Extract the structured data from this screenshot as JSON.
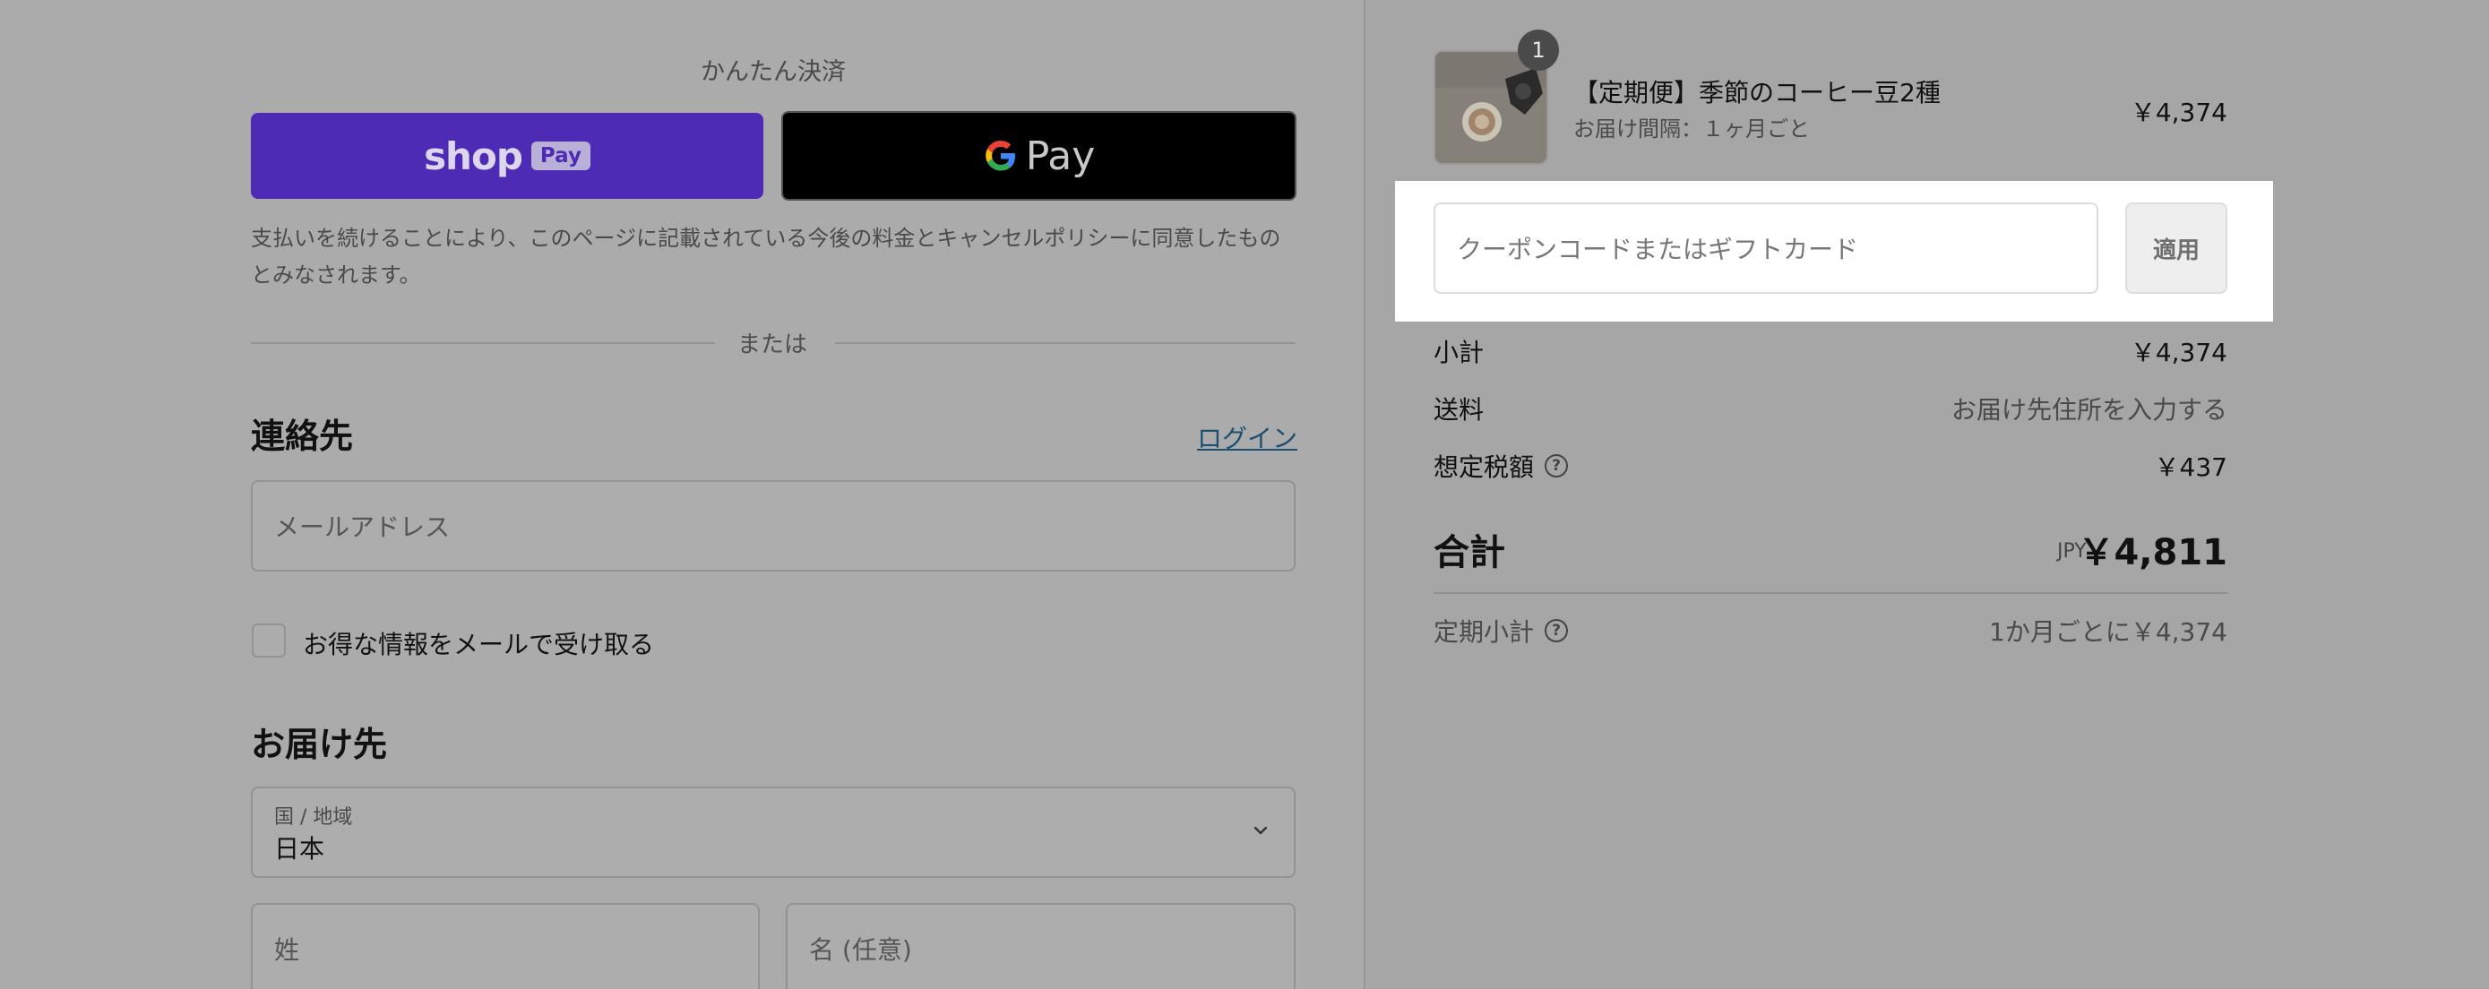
{
  "express_checkout": {
    "title": "かんたん決済",
    "shop_pay_wordmark": "shop",
    "shop_pay_badge": "Pay",
    "gpay_g": "G",
    "gpay_label": "Pay"
  },
  "notice_text": "支払いを続けることにより、このページに記載されている今後の料金とキャンセルポリシーに同意したものとみなされます。",
  "divider_text": "または",
  "contact": {
    "title": "連絡先",
    "login_link": "ログイン",
    "email_placeholder": "メールアドレス",
    "newsletter_label": "お得な情報をメールで受け取る"
  },
  "delivery": {
    "title": "お届け先",
    "country_label": "国 / 地域",
    "country_value": "日本",
    "last_name_placeholder": "姓",
    "first_name_placeholder": "名 (任意)"
  },
  "summary": {
    "item": {
      "quantity": "1",
      "title": "【定期便】季節のコーヒー豆2種",
      "subtitle": "お届け間隔：１ヶ月ごと",
      "price": "￥4,374"
    },
    "coupon": {
      "placeholder": "クーポンコードまたはギフトカード",
      "apply_label": "適用"
    },
    "subtotal_label": "小計",
    "subtotal_value": "￥4,374",
    "shipping_label": "送料",
    "shipping_value": "お届け先住所を入力する",
    "tax_label": "想定税額",
    "tax_value": "￥437",
    "total_label": "合計",
    "total_currency": "JPY",
    "total_value": "￥4,811",
    "recurring_label": "定期小計",
    "recurring_value": "1か月ごとに￥4,374",
    "help_glyph": "?"
  },
  "colors": {
    "shop_pay": "#4d2bb4",
    "gpay": "#000000",
    "link": "#1d4f73",
    "highlight_panel": "#ffffff"
  }
}
